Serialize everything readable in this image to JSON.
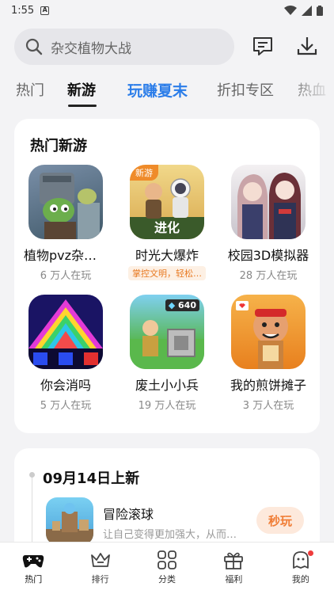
{
  "status_bar": {
    "time": "1:55",
    "notification_letter": "A"
  },
  "search": {
    "placeholder": "杂交植物大战"
  },
  "tabs": [
    {
      "label": "热门"
    },
    {
      "label": "新游"
    },
    {
      "label": "玩赚夏末"
    },
    {
      "label": "折扣专区"
    },
    {
      "label": "热血"
    }
  ],
  "hot_new": {
    "title": "热门新游",
    "games": [
      {
        "name": "植物pvz杂交版",
        "players": "6 万人在玩"
      },
      {
        "name": "时光大爆炸",
        "badge": "新游",
        "banner": "进化",
        "tag": "掌控文明，轻松…"
      },
      {
        "name": "校园3D模拟器",
        "players": "28 万人在玩"
      },
      {
        "name": "你会消吗",
        "players": "5 万人在玩"
      },
      {
        "name": "废土小小兵",
        "players": "19 万人在玩",
        "counter": "640"
      },
      {
        "name": "我的煎饼摊子",
        "players": "3 万人在玩"
      }
    ]
  },
  "new_releases": {
    "date": "09月14日上新",
    "item": {
      "name": "冒险滚球",
      "desc": "让自己变得更加强大，从而…",
      "button": "秒玩"
    }
  },
  "bottom_nav": [
    {
      "label": "热门",
      "icon": "gamepad-icon"
    },
    {
      "label": "排行",
      "icon": "crown-icon"
    },
    {
      "label": "分类",
      "icon": "grid-icon"
    },
    {
      "label": "福利",
      "icon": "gift-icon"
    },
    {
      "label": "我的",
      "icon": "profile-icon"
    }
  ],
  "colors": {
    "accent_blue": "#2b7de9",
    "accent_orange": "#f07c34",
    "badge_red": "#ef3c3c"
  }
}
